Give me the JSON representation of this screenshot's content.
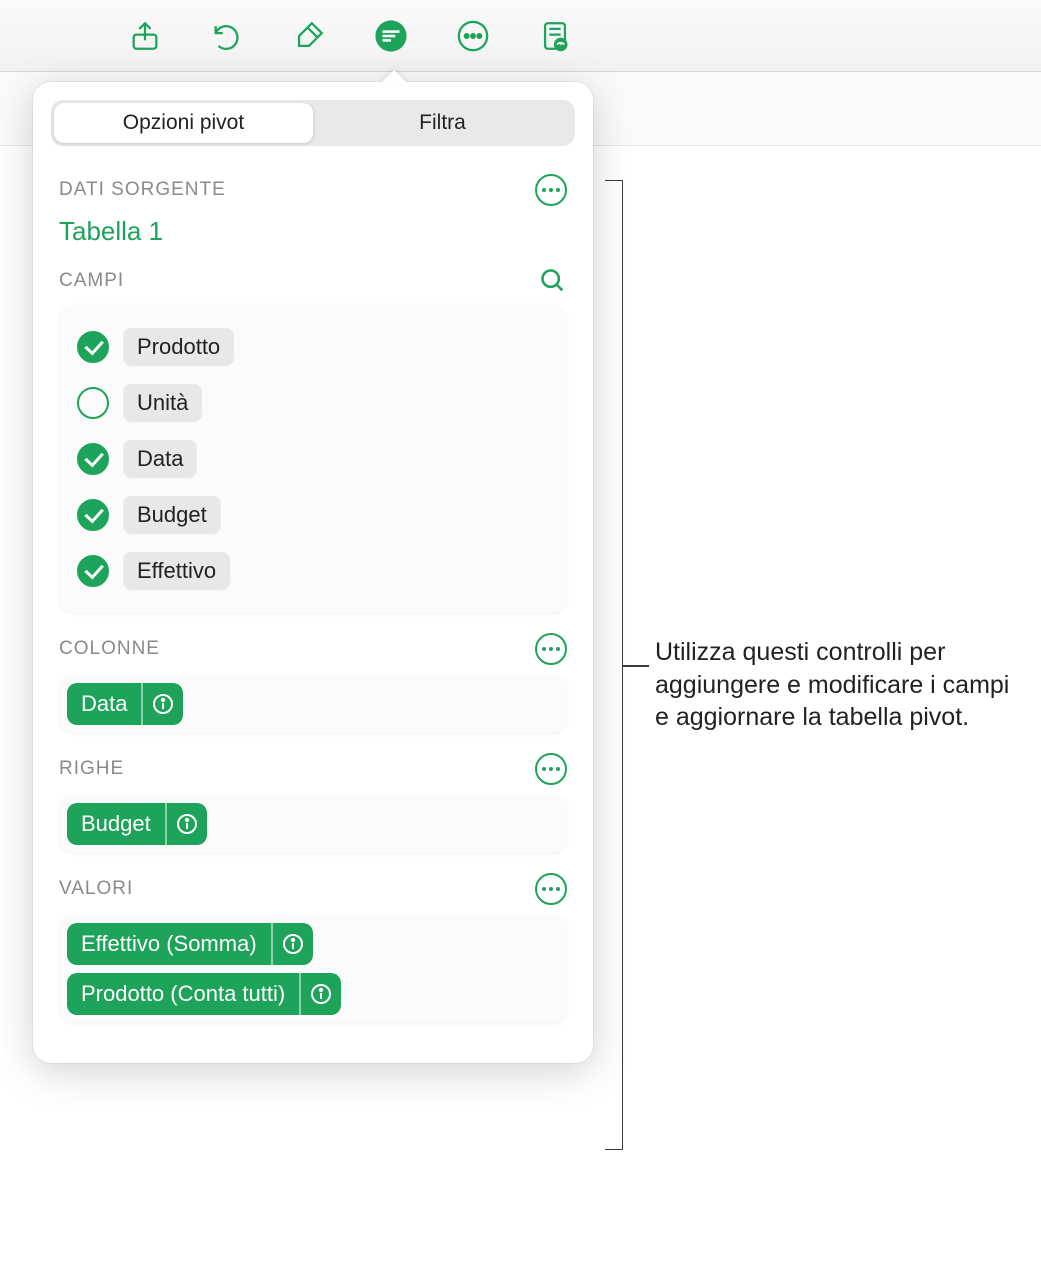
{
  "toolbar": {
    "icons": [
      "share-icon",
      "undo-icon",
      "format-brush-icon",
      "pivot-icon",
      "more-icon",
      "document-preview-icon"
    ]
  },
  "tabs": {
    "options": "Opzioni pivot",
    "filter": "Filtra"
  },
  "source": {
    "label": "DATI SORGENTE",
    "table": "Tabella 1"
  },
  "fields": {
    "label": "CAMPI",
    "items": [
      {
        "label": "Prodotto",
        "checked": true
      },
      {
        "label": "Unità",
        "checked": false
      },
      {
        "label": "Data",
        "checked": true
      },
      {
        "label": "Budget",
        "checked": true
      },
      {
        "label": "Effettivo",
        "checked": true
      }
    ]
  },
  "columns": {
    "label": "COLONNE",
    "chips": [
      "Data"
    ]
  },
  "rows": {
    "label": "RIGHE",
    "chips": [
      "Budget"
    ]
  },
  "values": {
    "label": "VALORI",
    "chips": [
      "Effettivo (Somma)",
      "Prodotto (Conta tutti)"
    ]
  },
  "callout": "Utilizza questi controlli per aggiungere e modificare i campi e aggiornare la tabella pivot."
}
